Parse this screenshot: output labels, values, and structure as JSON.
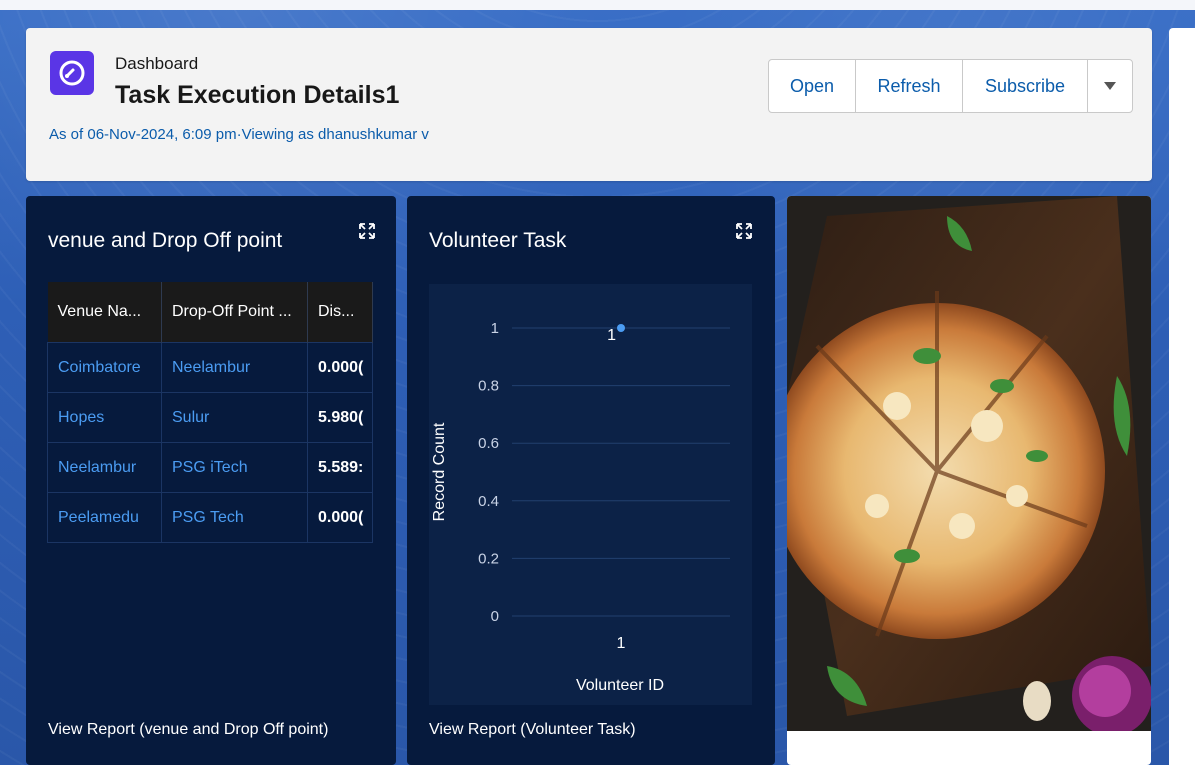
{
  "header": {
    "label": "Dashboard",
    "title": "Task Execution Details1",
    "subtitle": "As of 06-Nov-2024, 6:09 pm·Viewing as dhanushkumar v",
    "buttons": {
      "open": "Open",
      "refresh": "Refresh",
      "subscribe": "Subscribe"
    }
  },
  "venue_card": {
    "title": "venue and Drop Off point",
    "columns": [
      "Venue Na...",
      "Drop-Off Point ...",
      "Dis..."
    ],
    "rows": [
      [
        "Coimbatore",
        "Neelambur",
        "0.000("
      ],
      [
        "Hopes",
        "Sulur",
        "5.980("
      ],
      [
        "Neelambur",
        "PSG iTech",
        "5.589:"
      ],
      [
        "Peelamedu",
        "PSG Tech",
        "0.000("
      ]
    ],
    "footer": "View Report (venue and Drop Off point)"
  },
  "volunteer_card": {
    "title": "Volunteer Task",
    "footer": "View Report (Volunteer Task)"
  },
  "chart_data": {
    "type": "scatter",
    "title": "Volunteer Task",
    "xlabel": "Volunteer ID",
    "ylabel": "Record Count",
    "categories": [
      "1"
    ],
    "values": [
      1
    ],
    "data_labels": [
      "1"
    ],
    "y_ticks": [
      "1",
      "0.8",
      "0.6",
      "0.4",
      "0.2",
      "0"
    ],
    "ylim": [
      0,
      1
    ],
    "grid": true,
    "point_color": "#4b9cf2"
  },
  "colors": {
    "accent": "#0b5cab",
    "card_bg": "#061a3d",
    "link": "#4b9cf2",
    "icon_bg": "#5a35e6"
  },
  "icons": {
    "dashboard": "dashboard-gauge-icon",
    "expand": "expand-icon",
    "dropdown": "chevron-down-icon"
  }
}
